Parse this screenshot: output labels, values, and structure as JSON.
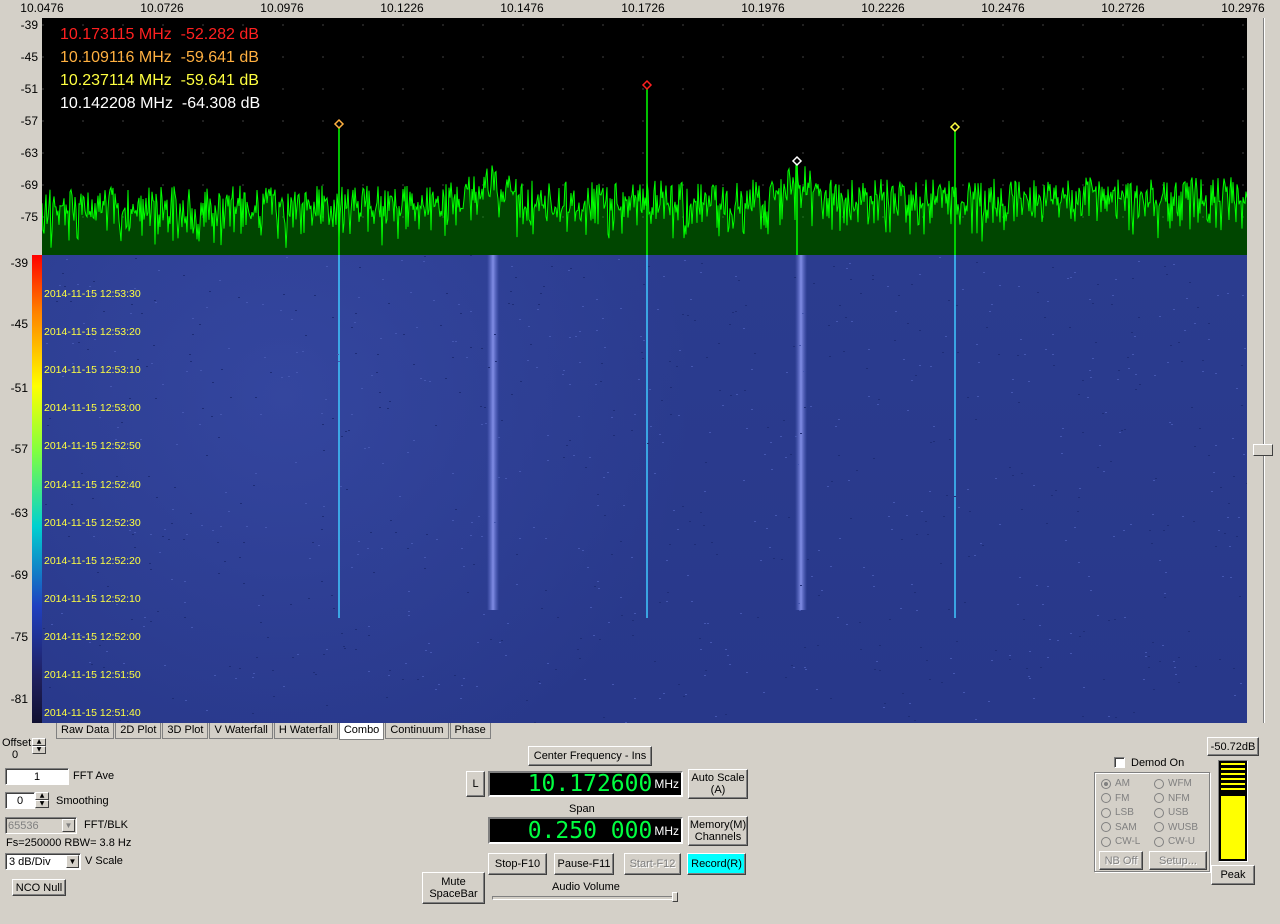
{
  "freq_scale": [
    "10.0476",
    "10.0726",
    "10.0976",
    "10.1226",
    "10.1476",
    "10.1726",
    "10.1976",
    "10.2226",
    "10.2476",
    "10.2726",
    "10.2976"
  ],
  "spectrum_db_labels": [
    "-39",
    "-45",
    "-51",
    "-57",
    "-63",
    "-69",
    "-75"
  ],
  "markers": [
    {
      "freq": "10.173115 MHz",
      "level": "-52.282 dB",
      "color": "#ff2020"
    },
    {
      "freq": "10.109116 MHz",
      "level": "-59.641 dB",
      "color": "#ffb040"
    },
    {
      "freq": "10.237114 MHz",
      "level": "-59.641 dB",
      "color": "#ffff40"
    },
    {
      "freq": "10.142208 MHz",
      "level": "-64.308 dB",
      "color": "#ffffff"
    }
  ],
  "waterfall_db_labels": [
    "-39",
    "-45",
    "-51",
    "-57",
    "-63",
    "-69",
    "-75",
    "-81"
  ],
  "timestamps": [
    "2014-11-15 12:53:30",
    "2014-11-15 12:53:20",
    "2014-11-15 12:53:10",
    "2014-11-15 12:53:00",
    "2014-11-15 12:52:50",
    "2014-11-15 12:52:40",
    "2014-11-15 12:52:30",
    "2014-11-15 12:52:20",
    "2014-11-15 12:52:10",
    "2014-11-15 12:52:00",
    "2014-11-15 12:51:50",
    "2014-11-15 12:51:40"
  ],
  "tabs": [
    "Raw Data",
    "2D Plot",
    "3D Plot",
    "V Waterfall",
    "H Waterfall",
    "Combo",
    "Continuum",
    "Phase"
  ],
  "active_tab": "Combo",
  "controls": {
    "offset_label": "Offset",
    "offset_value": "0",
    "fft_ave_value": "1",
    "fft_ave_label": "FFT Ave",
    "smoothing_value": "0",
    "smoothing_label": "Smoothing",
    "fft_blk_value": "65536",
    "fft_blk_label": "FFT/BLK",
    "fs_info": "Fs=250000 RBW= 3.8 Hz",
    "vscale_value": "3 dB/Div",
    "vscale_label": "V Scale",
    "nco_null": "NCO Null",
    "mute": "Mute\nSpaceBar",
    "center_freq_button": "Center Frequency - Ins",
    "l_button": "L",
    "center_freq_value": "10.172600",
    "freq_unit": "MHz",
    "auto_scale": "Auto Scale\n(A)",
    "span_label": "Span",
    "span_value": "0.250 000",
    "memory": "Memory(M)\nChannels",
    "stop": "Stop-F10",
    "pause": "Pause-F11",
    "start": "Start-F12",
    "record": "Record(R)",
    "audio_volume": "Audio Volume",
    "demod_on": "Demod On",
    "modes": [
      "AM",
      "WFM",
      "FM",
      "NFM",
      "LSB",
      "USB",
      "SAM",
      "WUSB",
      "CW-L",
      "CW-U"
    ],
    "nb_off": "NB Off",
    "setup": "Setup...",
    "level_readout": "-50.72dB",
    "peak": "Peak"
  },
  "level_meter_fraction": 0.66,
  "colors": {
    "trace": "#00ff00",
    "waterfall_bg": "#2b3c8f",
    "record_button": "#00ffff",
    "lcd_digits": "#00ff40"
  }
}
